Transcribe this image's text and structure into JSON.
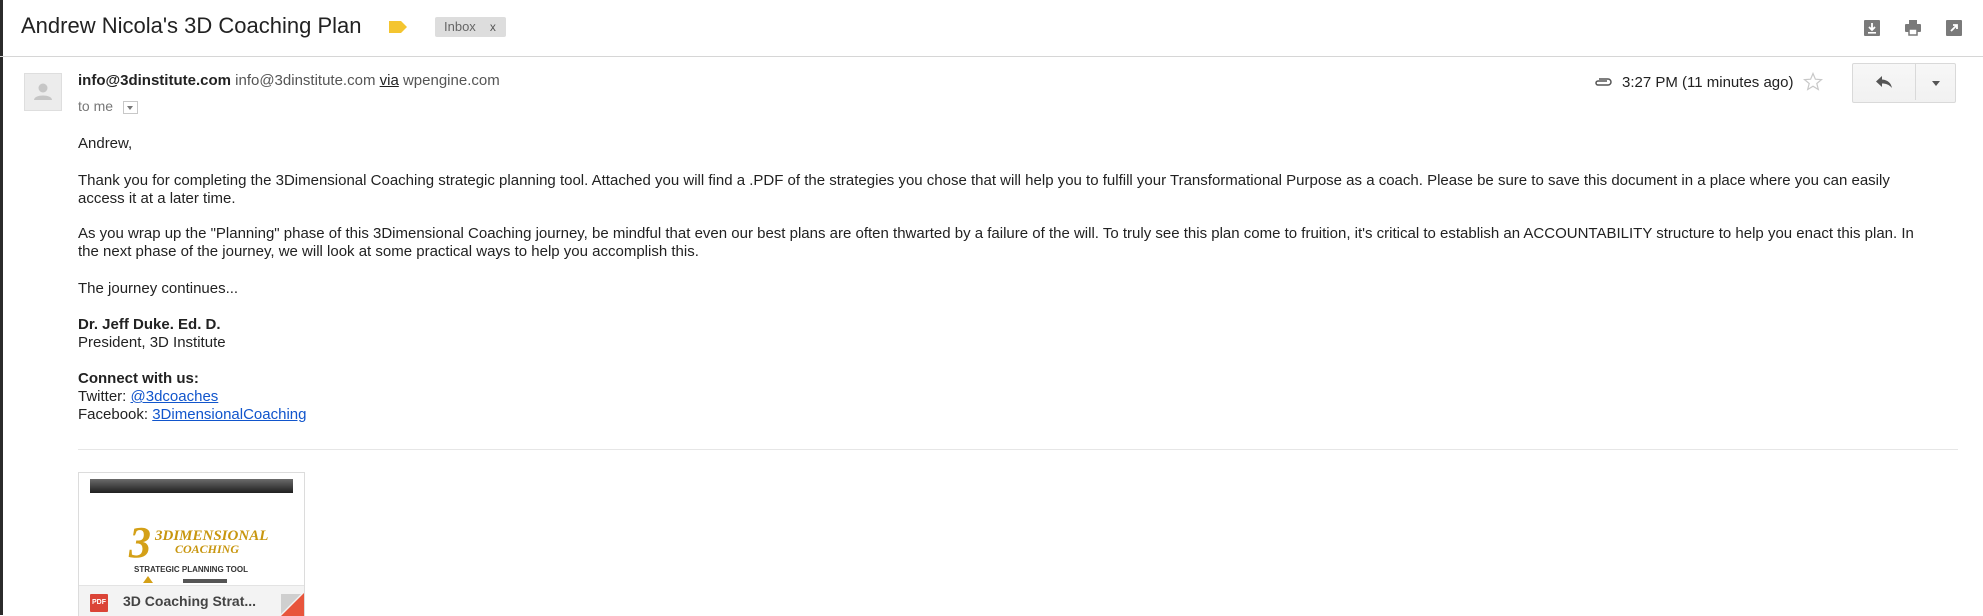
{
  "header": {
    "subject": "Andrew Nicola's 3D Coaching Plan",
    "label_chip": "Inbox",
    "label_chip_remove": "x",
    "icons": [
      "download-icon",
      "print-icon",
      "new-window-icon"
    ]
  },
  "message": {
    "sender_name": "info@3dinstitute.com",
    "sender_email": "info@3dinstitute.com",
    "via_label": "via",
    "via_domain": "wpengine.com",
    "to": "to me",
    "time": "3:27 PM (11 minutes ago)"
  },
  "body": {
    "greeting": "Andrew,",
    "paragraph1": "Thank you for completing the 3Dimensional Coaching strategic planning tool. Attached you will find a .PDF of the strategies you chose that will help you to fulfill your Transformational Purpose as a coach. Please be sure to save this document in a place where you can easily access it at a later time.",
    "paragraph2": "As you wrap up the \"Planning\" phase of this 3Dimensional Coaching journey, be mindful that even our best plans are often thwarted by a failure of the will. To truly see this plan come to fruition, it's critical to establish an ACCOUNTABILITY structure to help you enact this plan. In the next phase of the journey, we will look at some practical ways to help you accomplish this.",
    "closing": "The journey continues...",
    "signature_name": "Dr. Jeff Duke. Ed. D.",
    "signature_title": "President, 3D Institute",
    "connect_heading": "Connect with us:",
    "twitter_label": "Twitter: ",
    "twitter_handle": "@3dcoaches",
    "facebook_label": "Facebook: ",
    "facebook_handle": "3DimensionalCoaching"
  },
  "attachment": {
    "type_badge": "PDF",
    "name": "3D Coaching Strat...",
    "thumbnail_logo_main": "3DIMENSIONAL",
    "thumbnail_logo_sub": "COACHING",
    "thumbnail_caption": "STRATEGIC PLANNING TOOL"
  },
  "colors": {
    "link": "#1155cc",
    "label_tag": "#f4c530",
    "pdf_red": "#db4437"
  }
}
